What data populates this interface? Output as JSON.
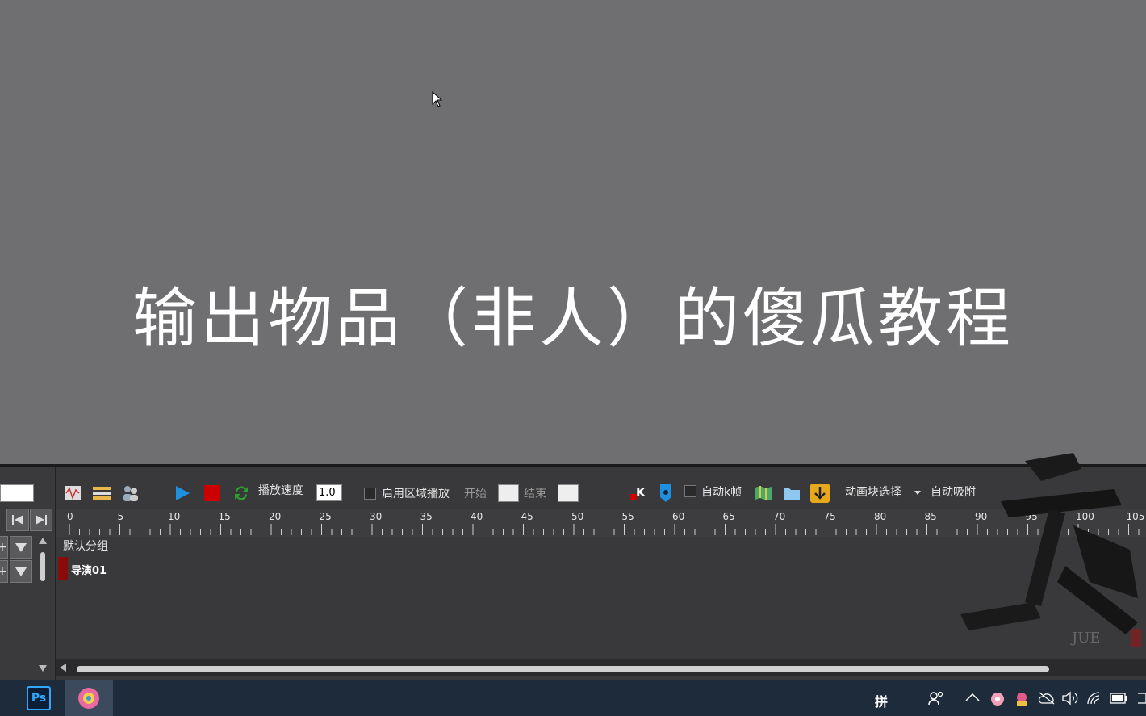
{
  "title": "输出物品（非人）的傻瓜教程",
  "toolbar": {
    "speed_label": "播放速度",
    "speed_value": "1.0",
    "region_play_label": "启用区域播放",
    "start_label": "开始",
    "end_label": "结束",
    "auto_k_label": "自动k帧",
    "block_select_label": "动画块选择",
    "auto_snap_label": "自动吸附"
  },
  "ruler": {
    "ticks": [
      "0",
      "5",
      "10",
      "15",
      "20",
      "25",
      "30",
      "35",
      "40",
      "45",
      "50",
      "55",
      "60",
      "65",
      "70",
      "75",
      "80",
      "85",
      "90",
      "95",
      "100",
      "105"
    ]
  },
  "tracks": {
    "group_label": "默认分组",
    "track_name": "导演01"
  },
  "watermark": {
    "text": "JUE"
  },
  "taskbar": {
    "ps_label": "Ps",
    "ime_label": "拼"
  },
  "colors": {
    "play": "#1f8fe0",
    "stop": "#cc0000",
    "track": "#8b0a0a"
  }
}
